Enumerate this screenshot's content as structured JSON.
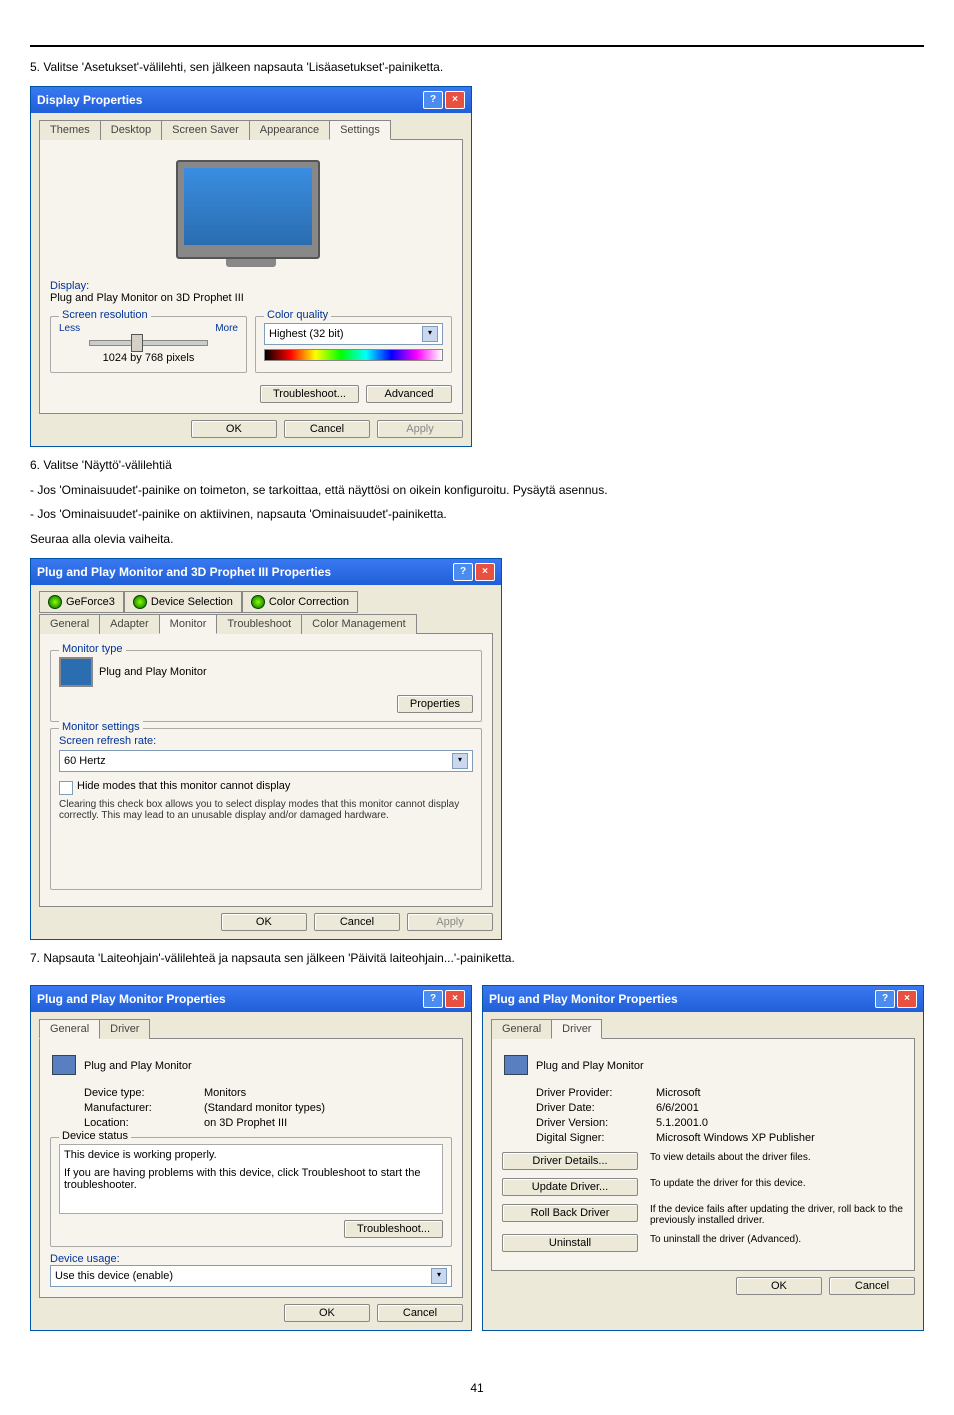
{
  "step5": "5. Valitse 'Asetukset'-välilehti, sen jälkeen napsauta 'Lisäasetukset'-painiketta.",
  "dlg1": {
    "title": "Display Properties",
    "tabs": {
      "themes": "Themes",
      "desktop": "Desktop",
      "ss": "Screen Saver",
      "appearance": "Appearance",
      "settings": "Settings"
    },
    "display_label": "Display:",
    "display_value": "Plug and Play Monitor on 3D Prophet III",
    "screen_res": "Screen resolution",
    "less": "Less",
    "more": "More",
    "res_value": "1024 by 768 pixels",
    "color_quality": "Color quality",
    "color_value": "Highest (32 bit)",
    "troubleshoot": "Troubleshoot...",
    "advanced": "Advanced",
    "ok": "OK",
    "cancel": "Cancel",
    "apply": "Apply"
  },
  "step6": "6. Valitse 'Näyttö'-välilehtiä",
  "step6a": "- Jos 'Ominaisuudet'-painike on toimeton, se tarkoittaa, että näyttösi on oikein konfiguroitu. Pysäytä asennus.",
  "step6b": "- Jos 'Ominaisuudet'-painike on aktiivinen, napsauta 'Ominaisuudet'-painiketta.",
  "step6c": "Seuraa alla olevia vaiheita.",
  "dlg2": {
    "title": "Plug and Play Monitor and 3D Prophet III Properties",
    "tabs_top": {
      "geforce": "GeForce3",
      "devsel": "Device Selection",
      "colorcorr": "Color Correction"
    },
    "tabs_bot": {
      "general": "General",
      "adapter": "Adapter",
      "monitor": "Monitor",
      "troubleshoot": "Troubleshoot",
      "colormgmt": "Color Management"
    },
    "monitor_type": "Monitor type",
    "mon_name": "Plug and Play Monitor",
    "properties": "Properties",
    "monitor_settings": "Monitor settings",
    "refresh_label": "Screen refresh rate:",
    "refresh_value": "60 Hertz",
    "hide_modes": "Hide modes that this monitor cannot display",
    "hide_note": "Clearing this check box allows you to select display modes that this monitor cannot display correctly. This may lead to an unusable display and/or damaged hardware.",
    "ok": "OK",
    "cancel": "Cancel",
    "apply": "Apply"
  },
  "step7": "7. Napsauta 'Laiteohjain'-välilehteä ja napsauta sen jälkeen 'Päivitä laiteohjain...'-painiketta.",
  "dlg3": {
    "title": "Plug and Play Monitor Properties",
    "tabs": {
      "general": "General",
      "driver": "Driver"
    },
    "device_name": "Plug and Play Monitor",
    "device_type_l": "Device type:",
    "device_type_v": "Monitors",
    "manufacturer_l": "Manufacturer:",
    "manufacturer_v": "(Standard monitor types)",
    "location_l": "Location:",
    "location_v": "on 3D Prophet III",
    "device_status": "Device status",
    "status_text": "This device is working properly.",
    "status_help": "If you are having problems with this device, click Troubleshoot to start the troubleshooter.",
    "troubleshoot": "Troubleshoot...",
    "device_usage": "Device usage:",
    "usage_value": "Use this device (enable)",
    "ok": "OK",
    "cancel": "Cancel"
  },
  "dlg4": {
    "title": "Plug and Play Monitor Properties",
    "tabs": {
      "general": "General",
      "driver": "Driver"
    },
    "device_name": "Plug and Play Monitor",
    "provider_l": "Driver Provider:",
    "provider_v": "Microsoft",
    "date_l": "Driver Date:",
    "date_v": "6/6/2001",
    "version_l": "Driver Version:",
    "version_v": "5.1.2001.0",
    "signer_l": "Digital Signer:",
    "signer_v": "Microsoft Windows XP Publisher",
    "details_btn": "Driver Details...",
    "details_desc": "To view details about the driver files.",
    "update_btn": "Update Driver...",
    "update_desc": "To update the driver for this device.",
    "rollback_btn": "Roll Back Driver",
    "rollback_desc": "If the device fails after updating the driver, roll back to the previously installed driver.",
    "uninstall_btn": "Uninstall",
    "uninstall_desc": "To uninstall the driver (Advanced).",
    "ok": "OK",
    "cancel": "Cancel"
  },
  "page_number": "41"
}
